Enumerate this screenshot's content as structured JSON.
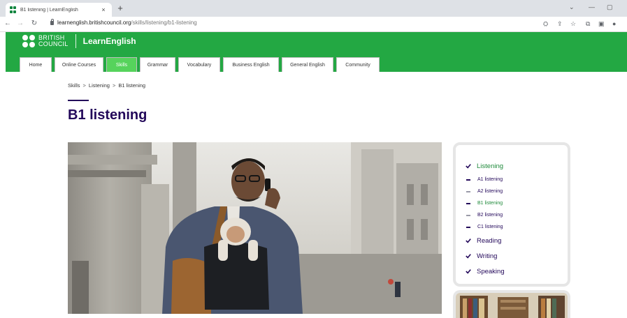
{
  "browser": {
    "tab_title": "B1 listening | LearnEnglish",
    "tab_close": "×",
    "new_tab": "+",
    "url_host": "learnenglish.britishcouncil.org",
    "url_path": "/skills/listening/b1-listening",
    "icons": [
      "back-arrow-icon",
      "forward-arrow-icon",
      "reload-icon",
      "lock-icon",
      "translate-icon",
      "share-icon",
      "star-icon",
      "extensions-icon",
      "sidepanel-icon",
      "profile-icon"
    ],
    "win_min": "—",
    "win_max": "▢",
    "win_chevron": "⌄"
  },
  "brand": {
    "logo_line1": "BRITISH",
    "logo_line2": "COUNCIL",
    "site_name": "LearnEnglish",
    "color_green": "#23a843",
    "color_active_tab": "#56d35c",
    "color_title": "#23085a"
  },
  "nav": {
    "items": [
      {
        "label": "Home"
      },
      {
        "label": "Online Courses"
      },
      {
        "label": "Skills",
        "active": true
      },
      {
        "label": "Grammar"
      },
      {
        "label": "Vocabulary"
      },
      {
        "label": "Business English"
      },
      {
        "label": "General English"
      },
      {
        "label": "Community"
      }
    ]
  },
  "breadcrumb": {
    "items": [
      "Skills",
      "Listening",
      "B1 listening"
    ],
    "separator": ">"
  },
  "page": {
    "title": "B1 listening"
  },
  "hero": {
    "alt": "Man with glasses on phone carrying a baby in a carrier on a city street"
  },
  "sidebar": {
    "items": [
      {
        "label": "Listening",
        "level": "main",
        "current": true
      },
      {
        "label": "A1 listening",
        "level": "sub"
      },
      {
        "label": "A2 listening",
        "level": "sub",
        "muted": true
      },
      {
        "label": "B1 listening",
        "level": "sub",
        "current": true
      },
      {
        "label": "B2 listening",
        "level": "sub",
        "muted": true
      },
      {
        "label": "C1 listening",
        "level": "sub"
      },
      {
        "label": "Reading",
        "level": "main"
      },
      {
        "label": "Writing",
        "level": "main"
      },
      {
        "label": "Speaking",
        "level": "main"
      }
    ]
  }
}
